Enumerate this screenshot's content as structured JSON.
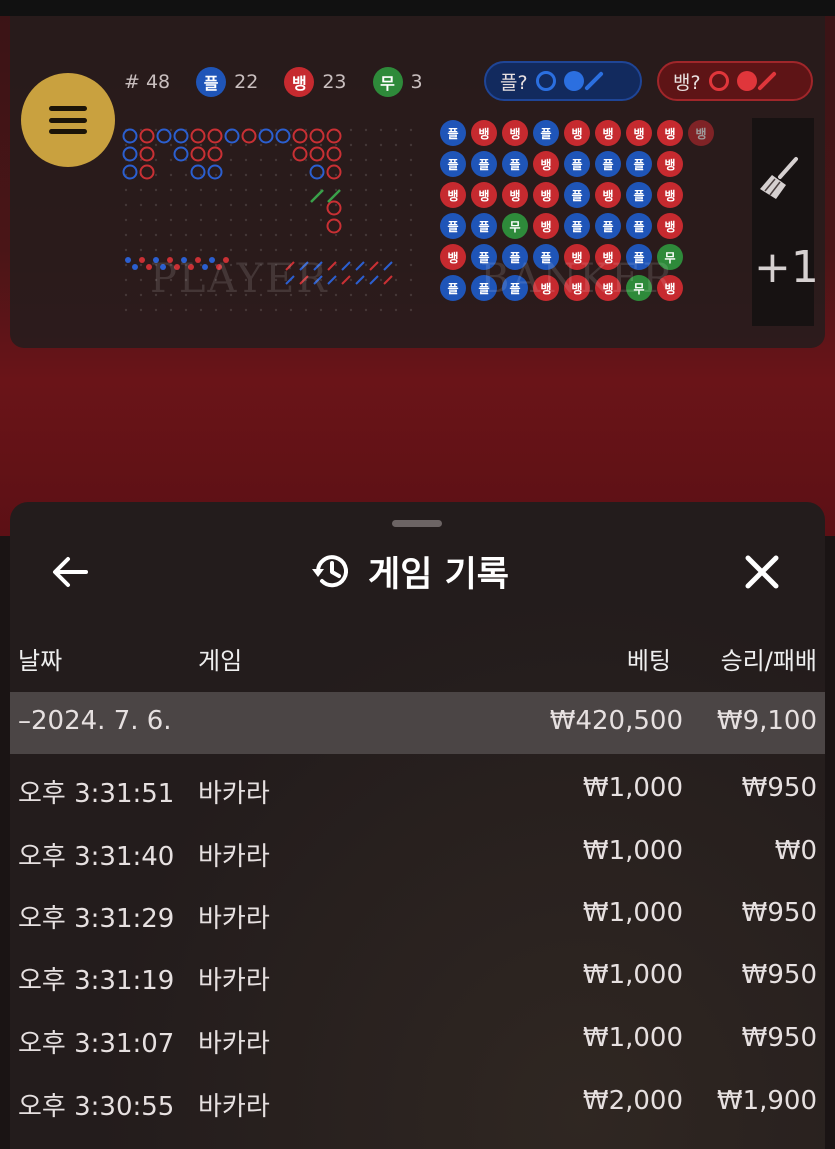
{
  "game": {
    "round_label": "# 48",
    "stats": [
      {
        "badge": "플",
        "count": "22",
        "color": "#1f55b8"
      },
      {
        "badge": "뱅",
        "count": "23",
        "color": "#c62a2f"
      },
      {
        "badge": "무",
        "count": "3",
        "color": "#2e8a3a"
      }
    ],
    "player_predict_label": "플?",
    "banker_predict_label": "뱅?",
    "plus_label": "+1",
    "watermark_left": "PLAYER",
    "watermark_right": "BANKER",
    "bead_rows": [
      [
        "플",
        "뱅",
        "뱅",
        "플",
        "뱅",
        "뱅",
        "뱅",
        "뱅",
        "뱅"
      ],
      [
        "플",
        "플",
        "플",
        "뱅",
        "플",
        "플",
        "플",
        "뱅"
      ],
      [
        "뱅",
        "뱅",
        "뱅",
        "뱅",
        "플",
        "뱅",
        "플",
        "뱅"
      ],
      [
        "플",
        "플",
        "무",
        "뱅",
        "플",
        "플",
        "플",
        "뱅"
      ],
      [
        "뱅",
        "플",
        "플",
        "플",
        "뱅",
        "뱅",
        "플",
        "무"
      ],
      [
        "플",
        "플",
        "플",
        "뱅",
        "뱅",
        "뱅",
        "무",
        "뱅"
      ]
    ],
    "colors": {
      "player": "#1f55b8",
      "banker": "#c62a2f",
      "tie": "#2e8a3a",
      "gold": "#c9a13f"
    }
  },
  "history": {
    "title": "게임 기록",
    "columns": {
      "date": "날짜",
      "game": "게임",
      "bet": "베팅",
      "result": "승리/패배"
    },
    "date_group": {
      "date": "–2024. 7. 6.",
      "bet": "₩420,500",
      "result": "₩9,100"
    },
    "rows": [
      {
        "time": "오후 3:31:51",
        "game": "바카라",
        "bet": "₩1,000",
        "result": "₩950"
      },
      {
        "time": "오후 3:31:40",
        "game": "바카라",
        "bet": "₩1,000",
        "result": "₩0"
      },
      {
        "time": "오후 3:31:29",
        "game": "바카라",
        "bet": "₩1,000",
        "result": "₩950"
      },
      {
        "time": "오후 3:31:19",
        "game": "바카라",
        "bet": "₩1,000",
        "result": "₩950"
      },
      {
        "time": "오후 3:31:07",
        "game": "바카라",
        "bet": "₩1,000",
        "result": "₩950"
      },
      {
        "time": "오후 3:30:55",
        "game": "바카라",
        "bet": "₩2,000",
        "result": "₩1,900"
      }
    ]
  }
}
